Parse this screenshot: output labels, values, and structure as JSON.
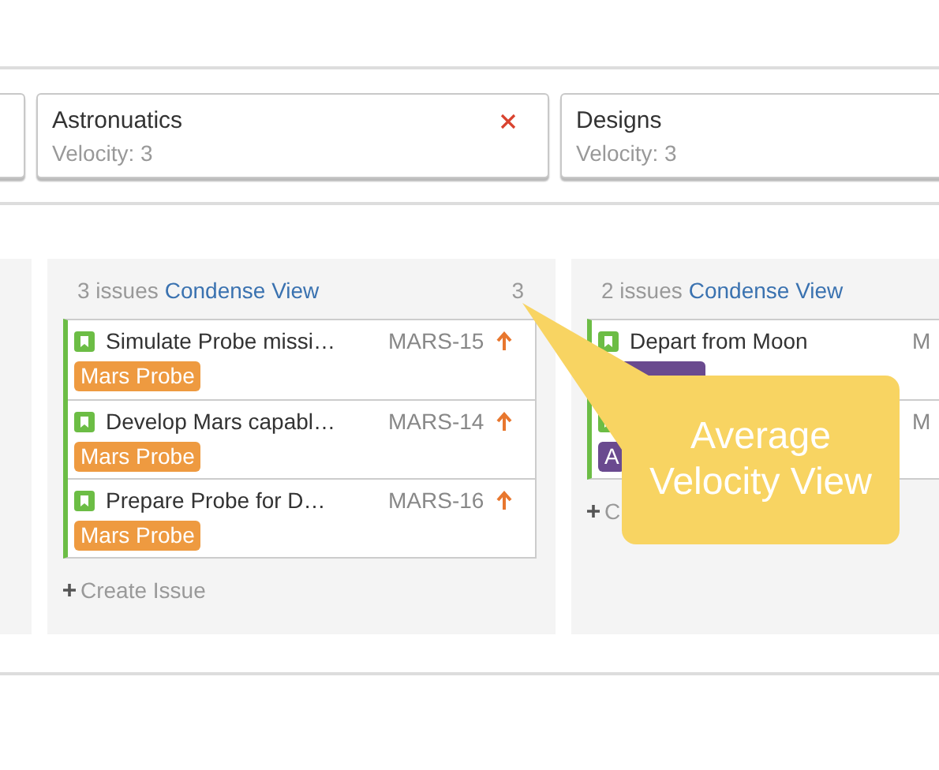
{
  "sprints": [
    {
      "kind": "stub"
    },
    {
      "name": "Astronuatics",
      "velocity": "Velocity: 3",
      "removable": true,
      "kind": "full"
    },
    {
      "name": "Designs",
      "velocity": "Velocity: 3",
      "removable": false,
      "kind": "full"
    }
  ],
  "columns": [
    {
      "kind": "stub"
    },
    {
      "kind": "full",
      "count": "3 issues",
      "link": "Condense View",
      "points": "3",
      "create": "Create Issue",
      "issues": [
        {
          "title": "Simulate Probe missi…",
          "key": "MARS-15",
          "priority_arrow": true,
          "tag": {
            "label": "Mars Probe",
            "color": "#ee9a40"
          }
        },
        {
          "title": "Develop Mars capabl…",
          "key": "MARS-14",
          "priority_arrow": true,
          "tag": {
            "label": "Mars Probe",
            "color": "#ee9a40"
          }
        },
        {
          "title": "Prepare Probe for D…",
          "key": "MARS-16",
          "priority_arrow": true,
          "tag": {
            "label": "Mars Probe",
            "color": "#ee9a40"
          }
        }
      ]
    },
    {
      "kind": "full",
      "count": "2 issues",
      "link": "Condense View",
      "create": "C",
      "issues": [
        {
          "title": "Depart from Moon",
          "key": "M",
          "priority_arrow": false,
          "tag": {
            "color": "#6a4a8f"
          }
        },
        {
          "key": "M",
          "priority_arrow": false,
          "tag": {
            "label": "A",
            "color": "#6a4a8f"
          }
        }
      ]
    }
  ],
  "callout": {
    "text": "Average Velocity View"
  }
}
